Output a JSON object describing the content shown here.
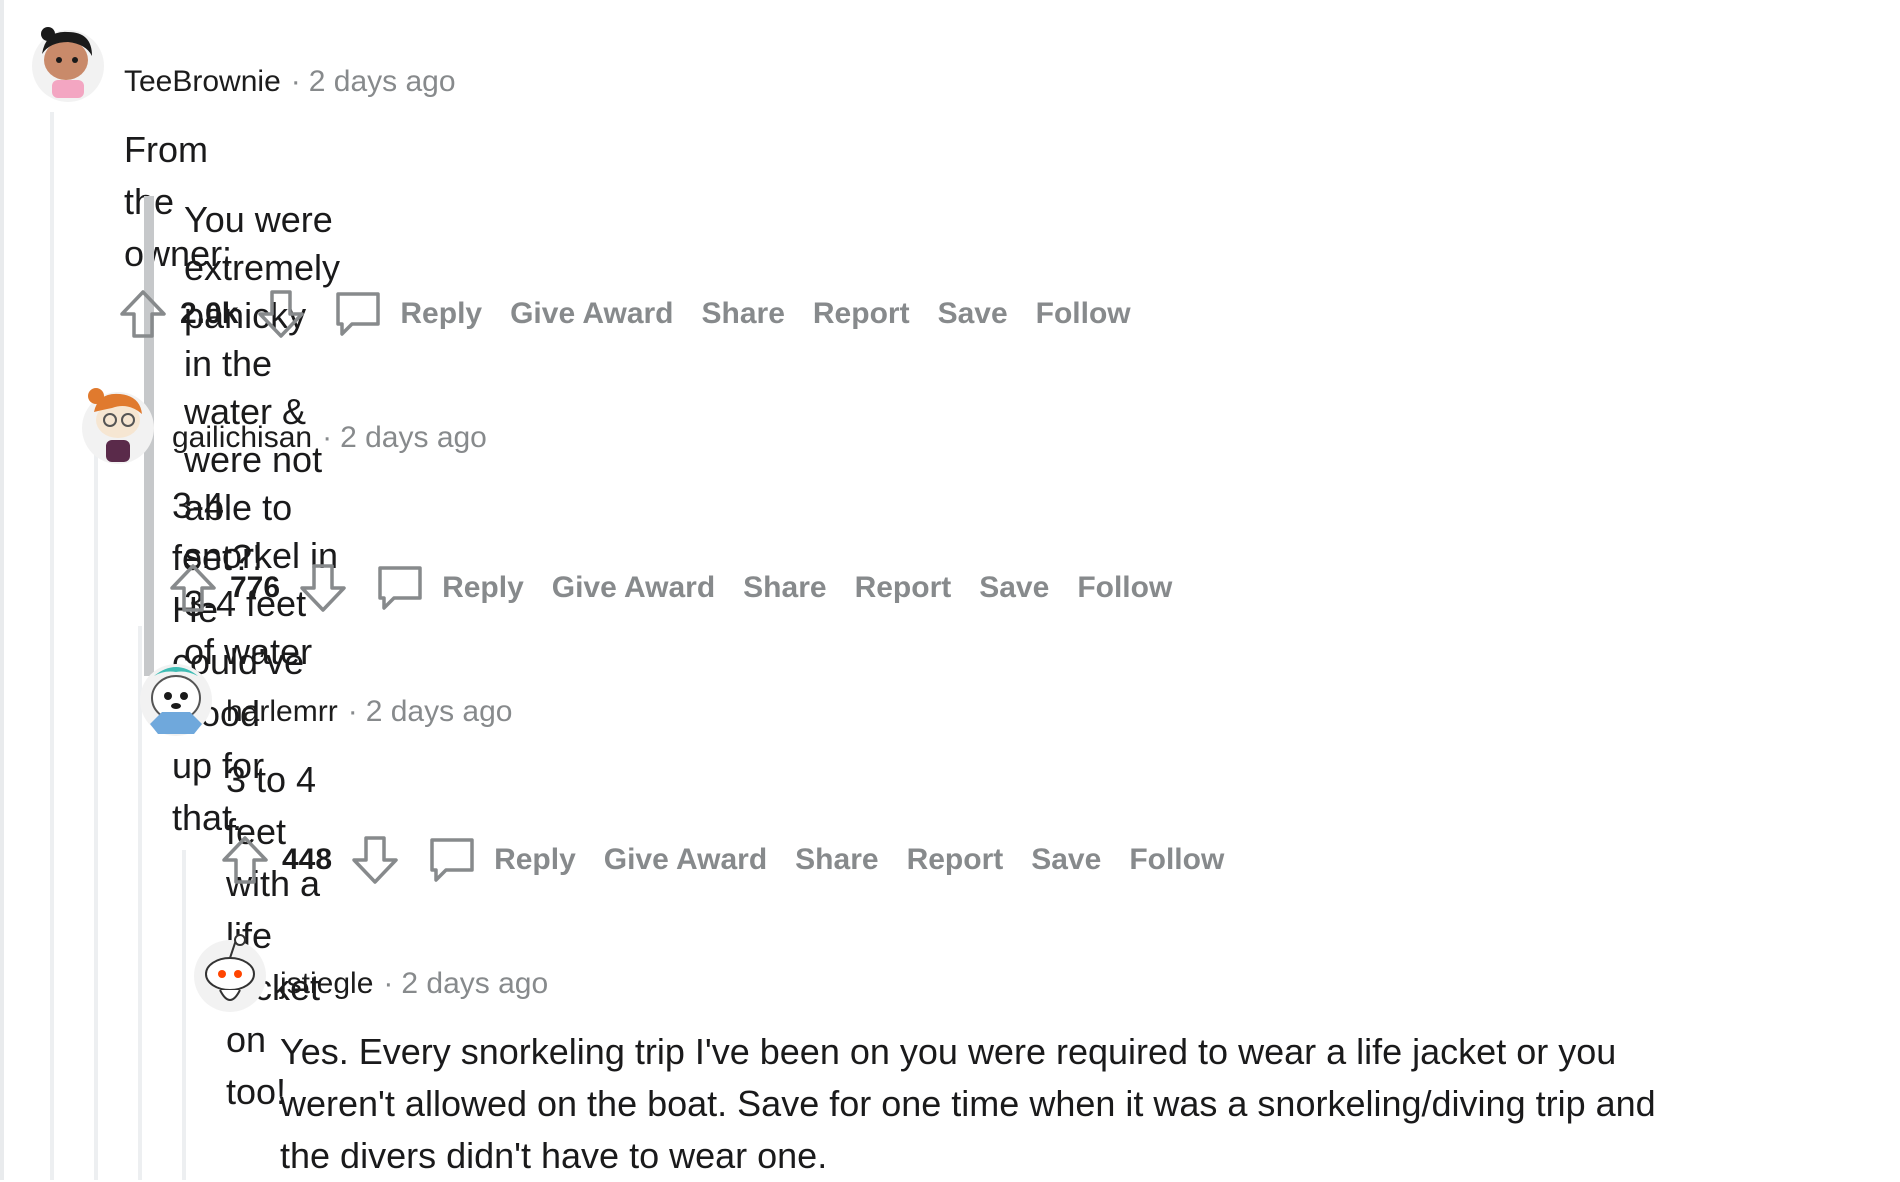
{
  "comments": [
    {
      "username": "TeeBrownie",
      "separator": "·",
      "time": "2 days ago",
      "body": "From the owner:",
      "quote": "You were extremely panicky in the water & were not able to snorkel in 3-4 feet of water",
      "votes": "2.0k",
      "actions": [
        "Reply",
        "Give Award",
        "Share",
        "Report",
        "Save",
        "Follow"
      ]
    },
    {
      "username": "gailichisan",
      "separator": "·",
      "time": "2 days ago",
      "body": "3-4 feet?! He could’ve stood up for that.",
      "votes": "776",
      "actions": [
        "Reply",
        "Give Award",
        "Share",
        "Report",
        "Save",
        "Follow"
      ]
    },
    {
      "username": "harlemrr",
      "separator": "·",
      "time": "2 days ago",
      "body": "3 to 4 feet with a life jacket on too!",
      "votes": "448",
      "actions": [
        "Reply",
        "Give Award",
        "Share",
        "Report",
        "Save",
        "Follow"
      ]
    },
    {
      "username": "jstiegle",
      "separator": "·",
      "time": "2 days ago",
      "body_lines": [
        "Yes. Every snorkeling trip I've been on you were required to wear a life jacket or you",
        "weren't allowed on the boat. Save for one time when it was a snorkeling/diving trip and",
        "the divers didn't have to wear one."
      ]
    }
  ],
  "icons": {
    "upvote": "upvote-arrow-icon",
    "downvote": "downvote-arrow-icon",
    "comment": "comment-bubble-icon",
    "avatar": "snoo-avatar"
  },
  "colors": {
    "meta_text": "#878a8c",
    "body_text": "#1a1a1b",
    "thread_line": "#edeff1",
    "quote_bar": "#c6c8ca"
  }
}
